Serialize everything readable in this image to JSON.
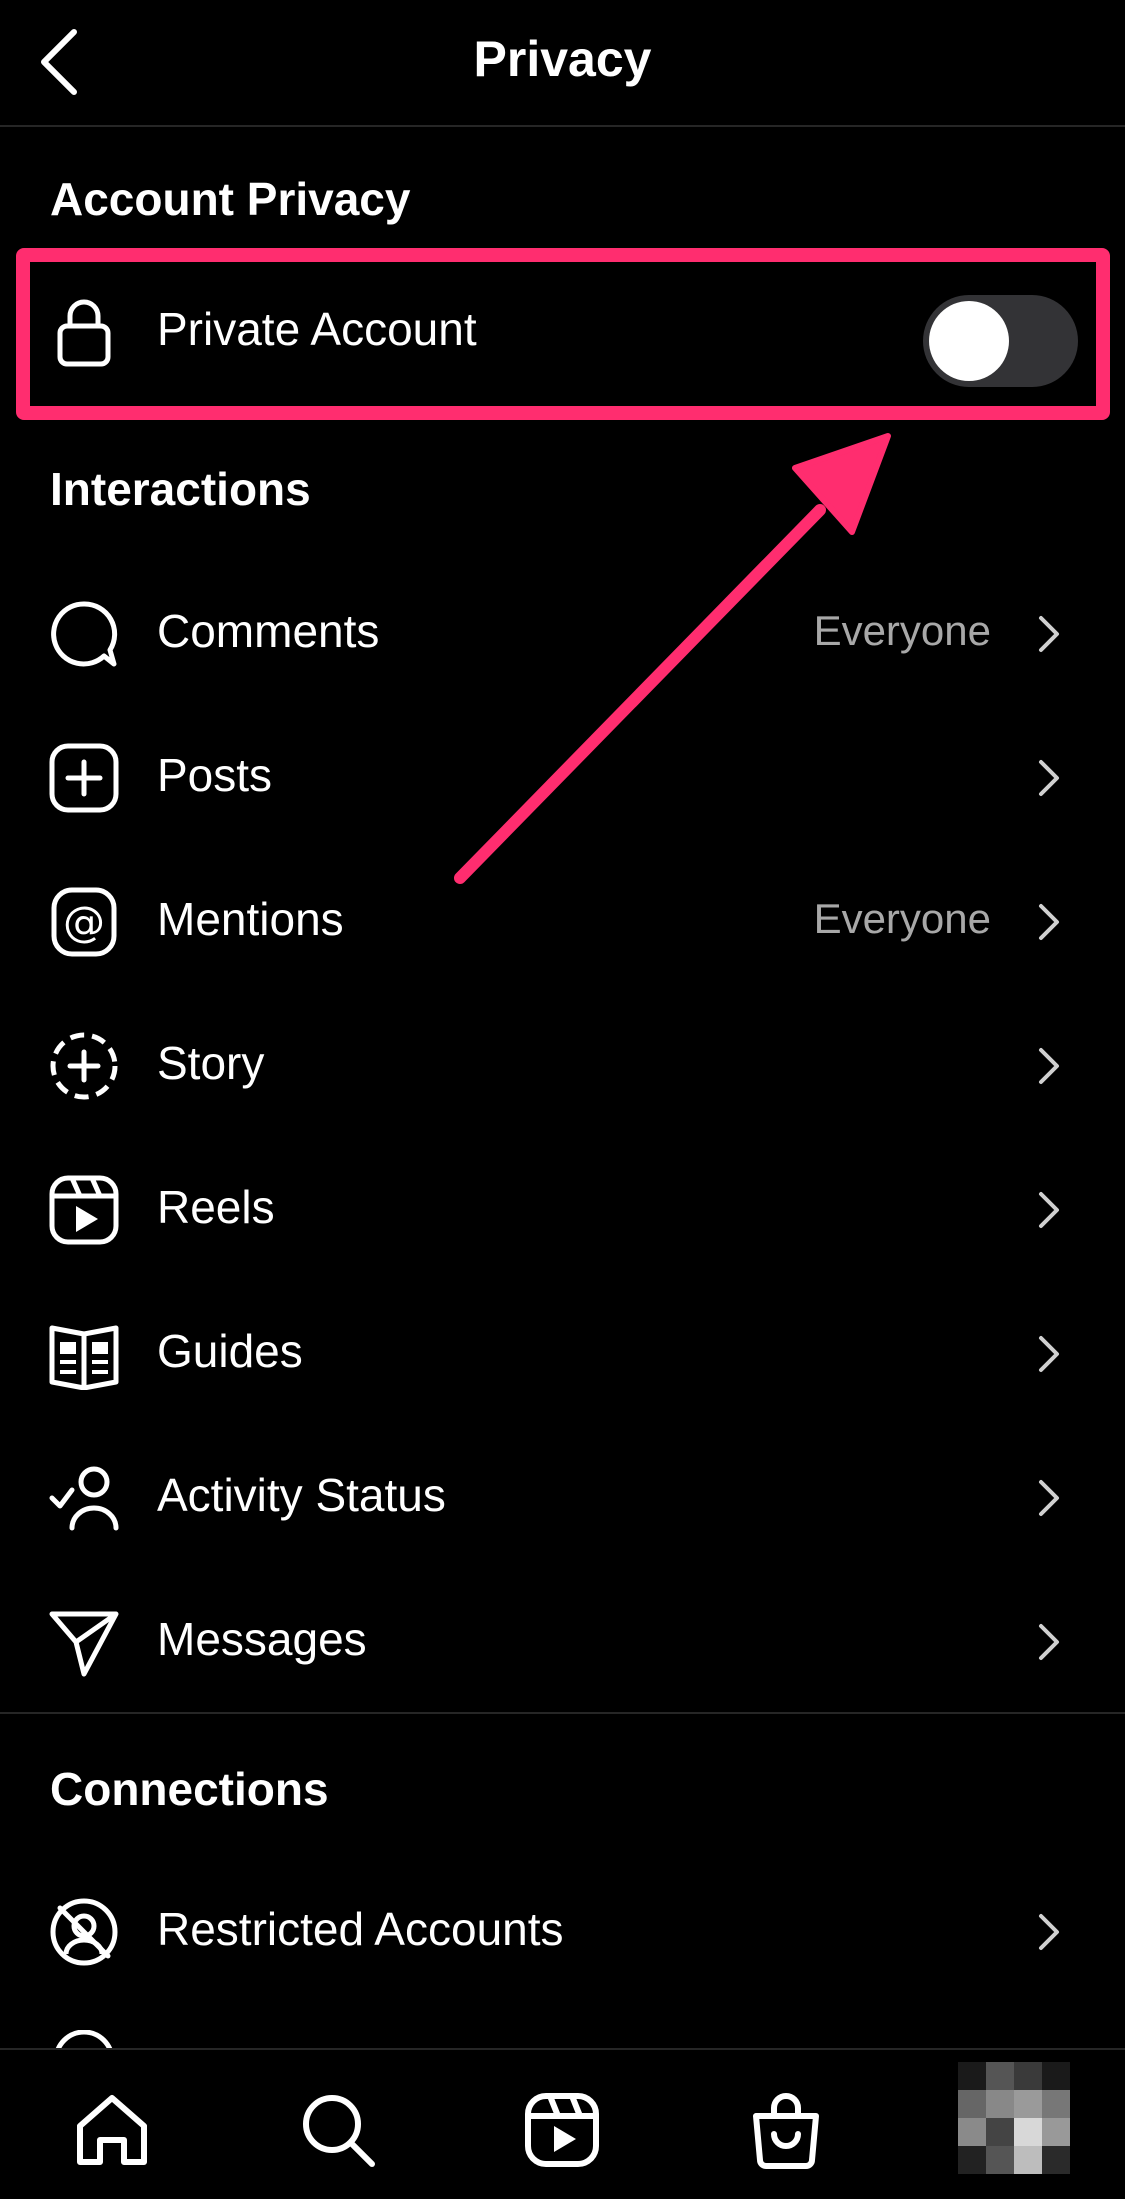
{
  "header": {
    "title": "Privacy"
  },
  "sections": {
    "account_privacy": "Account Privacy",
    "interactions": "Interactions",
    "connections": "Connections"
  },
  "private_account": {
    "label": "Private Account",
    "enabled": false
  },
  "interactions": [
    {
      "label": "Comments",
      "value": "Everyone",
      "icon": "comment-icon"
    },
    {
      "label": "Posts",
      "value": "",
      "icon": "plus-square-icon"
    },
    {
      "label": "Mentions",
      "value": "Everyone",
      "icon": "at-sign-icon"
    },
    {
      "label": "Story",
      "value": "",
      "icon": "story-add-icon"
    },
    {
      "label": "Reels",
      "value": "",
      "icon": "reels-icon"
    },
    {
      "label": "Guides",
      "value": "",
      "icon": "guides-icon"
    },
    {
      "label": "Activity Status",
      "value": "",
      "icon": "activity-status-icon"
    },
    {
      "label": "Messages",
      "value": "",
      "icon": "paper-plane-icon"
    }
  ],
  "connections": [
    {
      "label": "Restricted Accounts",
      "icon": "restricted-icon"
    }
  ],
  "tabbar": [
    "home-icon",
    "search-icon",
    "reels-icon",
    "shop-icon",
    "profile-avatar"
  ],
  "colors": {
    "background": "#000000",
    "highlight": "#ff2d6f",
    "secondary_text": "#a8a8a8",
    "toggle_off": "#333336"
  }
}
